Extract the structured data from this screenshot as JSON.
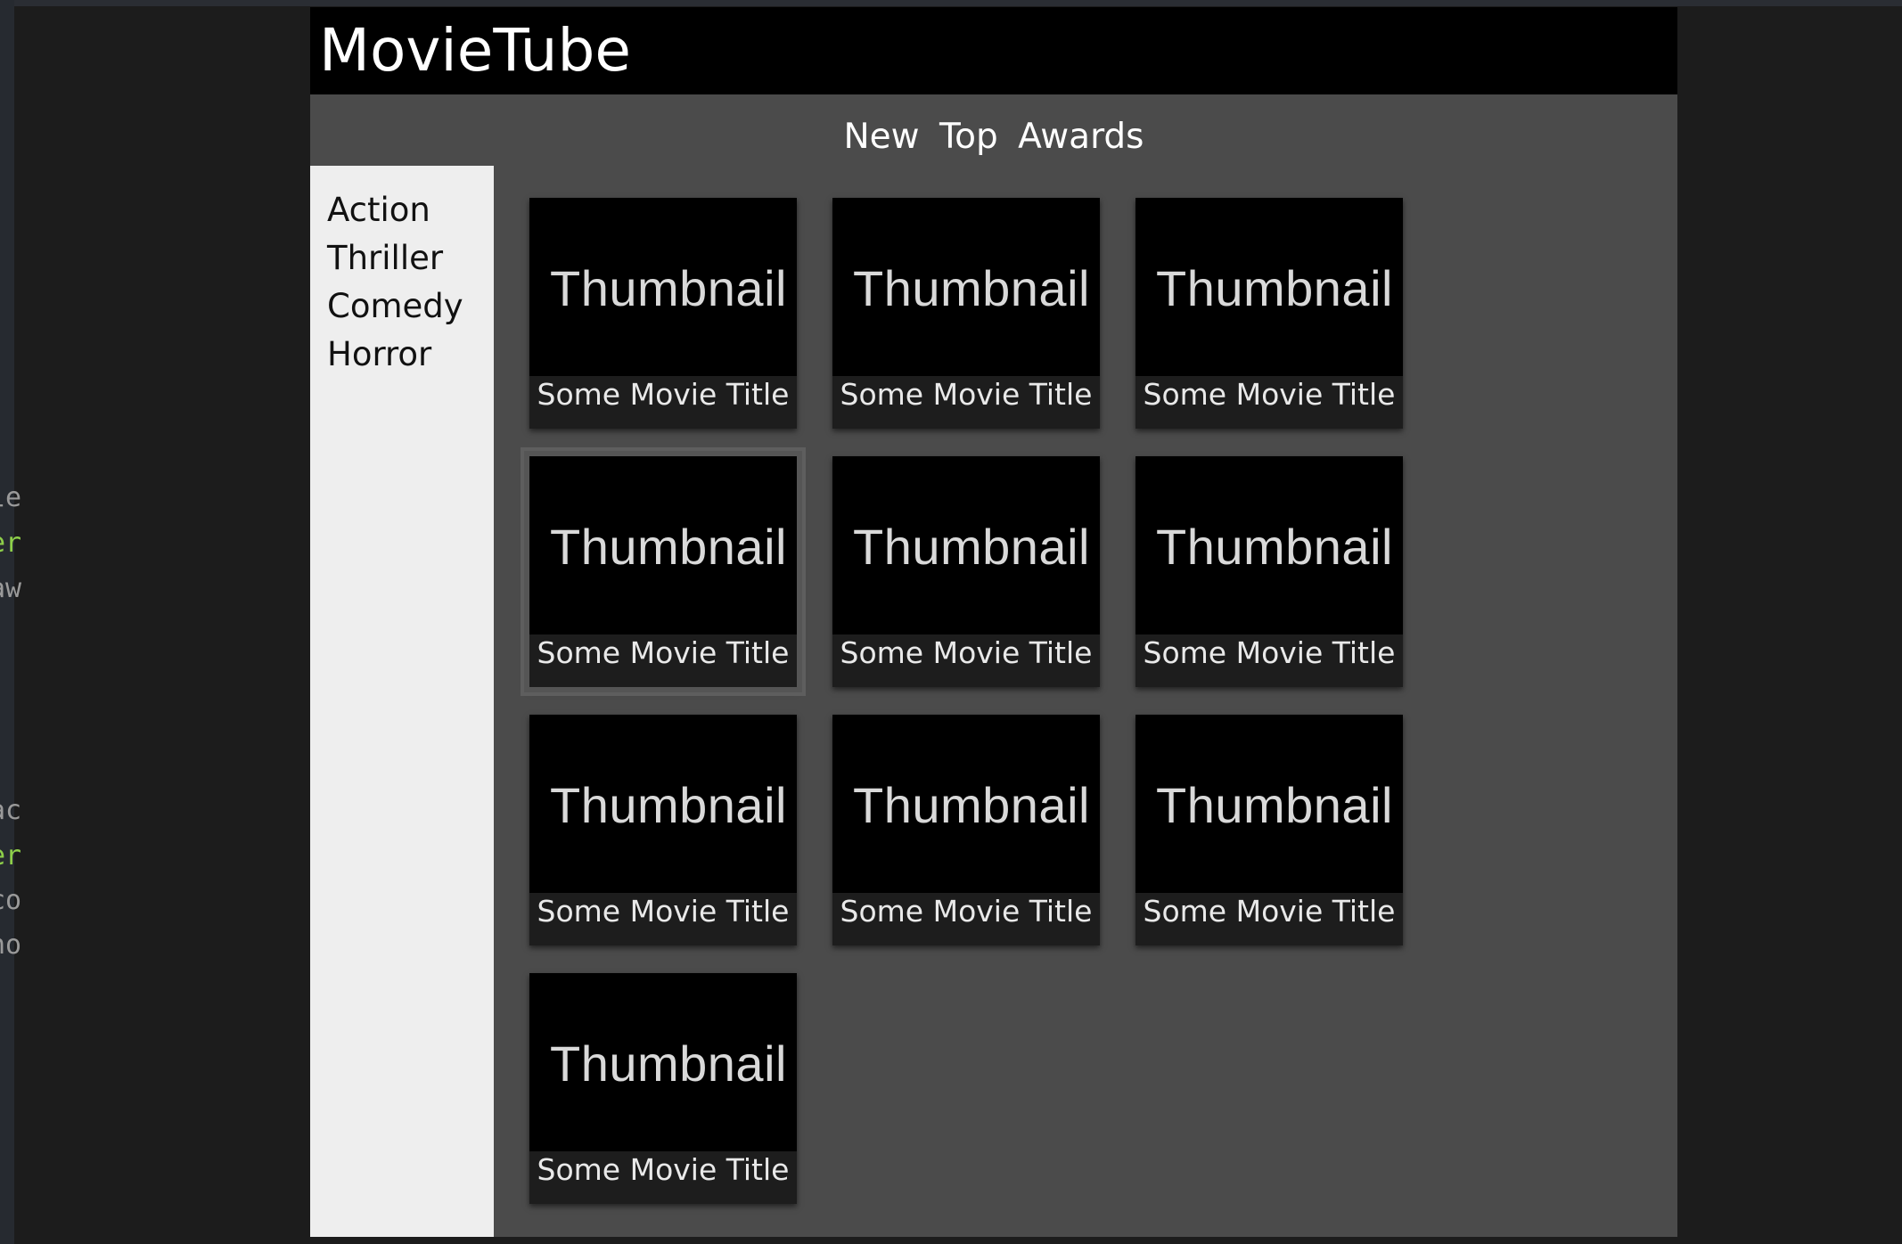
{
  "app": {
    "title": "MovieTube",
    "section_title": "New Top Awards"
  },
  "sidebar": {
    "items": [
      {
        "label": "Action"
      },
      {
        "label": "Thriller"
      },
      {
        "label": "Comedy"
      },
      {
        "label": "Horror"
      }
    ]
  },
  "movies": [
    {
      "thumbnail": "Thumbnail",
      "title": "Some Movie Title"
    },
    {
      "thumbnail": "Thumbnail",
      "title": "Some Movie Title"
    },
    {
      "thumbnail": "Thumbnail",
      "title": "Some Movie Title"
    },
    {
      "thumbnail": "Thumbnail",
      "title": "Some Movie Title"
    },
    {
      "thumbnail": "Thumbnail",
      "title": "Some Movie Title"
    },
    {
      "thumbnail": "Thumbnail",
      "title": "Some Movie Title"
    },
    {
      "thumbnail": "Thumbnail",
      "title": "Some Movie Title"
    },
    {
      "thumbnail": "Thumbnail",
      "title": "Some Movie Title"
    },
    {
      "thumbnail": "Thumbnail",
      "title": "Some Movie Title"
    },
    {
      "thumbnail": "Thumbnail",
      "title": "Some Movie Title"
    }
  ],
  "editor_gutter": {
    "glyphs": [
      "le",
      "er",
      "aw",
      "ac",
      "er",
      "co",
      "ho"
    ]
  },
  "colors": {
    "header_bg": "#000000",
    "content_bg": "#4b4b4b",
    "sidebar_bg": "#eeeeee",
    "caption_bg": "#1d1d1d",
    "gutter_green": "#8ecf4a"
  }
}
